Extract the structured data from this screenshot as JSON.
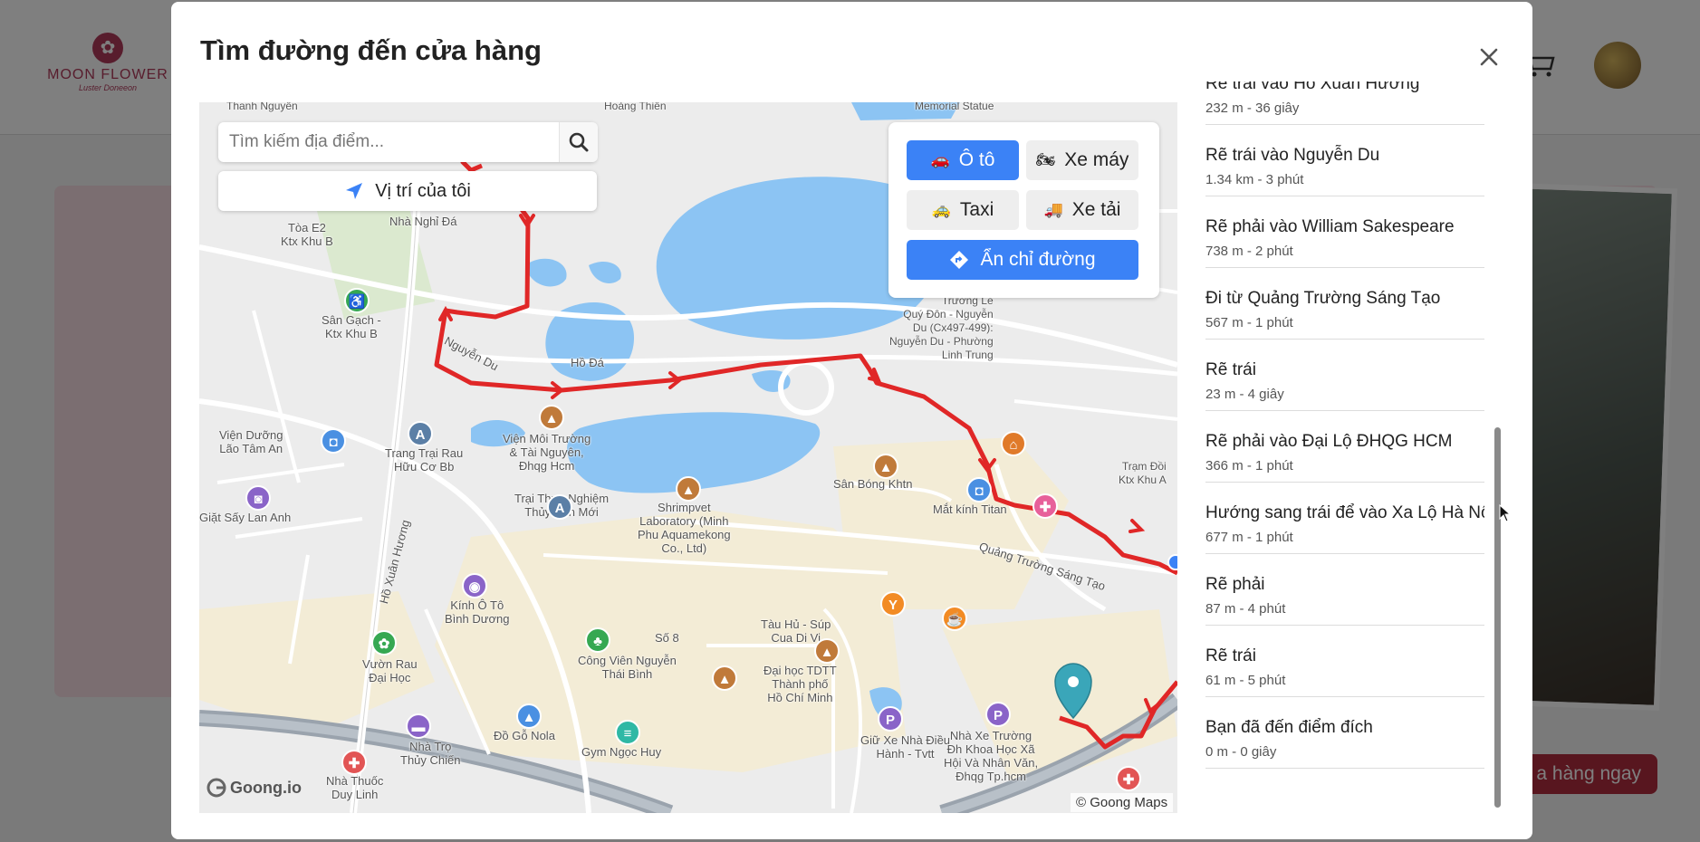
{
  "background": {
    "logo": {
      "name": "MOON FLOWER",
      "sub": "Luster Doneeon"
    },
    "cta_label": "a hàng ngay"
  },
  "modal": {
    "title": "Tìm đường đến cửa hàng",
    "close_icon": "close-icon"
  },
  "map": {
    "search_placeholder": "Tìm kiếm địa điểm...",
    "my_location_label": "Vị trí của tôi",
    "vehicles": [
      {
        "label": "Ô tô",
        "icon": "car-icon",
        "active": true
      },
      {
        "label": "Xe máy",
        "icon": "motorbike-icon",
        "active": false
      },
      {
        "label": "Taxi",
        "icon": "taxi-icon",
        "active": false
      },
      {
        "label": "Xe tải",
        "icon": "truck-icon",
        "active": false
      }
    ],
    "hide_route_label": "Ẩn chỉ đường",
    "brand": "Goong.io",
    "copyright": "© Goong Maps",
    "accent_color": "#3b82f6",
    "route_color": "#e02727",
    "labels": {
      "thanh_nguyen": "Thanh Nguyên",
      "hoang_thien": "Hoàng Thiên",
      "memorial": "Memorial Statue",
      "toa_e2": "Tòa E2\nKtx Khu B",
      "nha_nghi": "Nhà Nghỉ Đá",
      "san_gach": "Sân Gạch -\nKtx Khu B",
      "nguyen_du": "Nguyễn Du",
      "ho_da": "Hồ Đá",
      "truong_le": "Trường Lê\nQuý Đôn - Nguyễn\nDu (Cx497-499):\nNguyễn Du - Phường\nLinh Trung",
      "vien_duong_lao": "Viện Dưỡng\nLão Tâm An",
      "trang_trai": "Trang Trại Rau\nHữu Cơ Bb",
      "vien_moi_truong": "Viện Môi Trường\n& Tài Nguyên,\nĐhqg Hcm",
      "san_bong": "Sân Bóng Khtn",
      "tram_doi": "Trạm Đồi\nKtx Khu A",
      "giat_say": "Giặt Sấy Lan Anh",
      "trai_thuc_nghiem": "Trại Thực Nghiệm\nThủy Sản Mới",
      "shrimpvet": "Shrimpvet\nLaboratory (Minh\nPhu Aquamekong\nCo., Ltd)",
      "mat_kinh": "Mắt kính Titan",
      "quang_truong": "Quảng Trường Sáng Tạo",
      "ho_xuan_huong": "Hồ Xuân Hương",
      "kinh_o_to": "Kính Ô Tô\nBình Dương",
      "so_8": "Số 8",
      "tau_hu": "Tàu Hủ - Súp\nCua Di Vi",
      "vuon_rau": "Vườn Rau\nĐại Học",
      "cong_vien": "Công Viên Nguyễn\nThái Bình",
      "dai_hoc_tdtt": "Đại học TDTT\nThành phố\nHồ Chí Minh",
      "nha_tro": "Nhà Trọ\nThủy Chiến",
      "do_go": "Đồ Gỗ Nola",
      "gym": "Gym Ngọc Huy",
      "giu_xe": "Giữ Xe Nhà Điều\nHành - Tvtt",
      "nha_xe_truong": "Nhà Xe Trường\nĐh Khoa Học Xã\nHội Và Nhân Văn,\nĐhqg Tp.hcm",
      "nha_thuoc": "Nhà Thuốc\nDuy Linh"
    }
  },
  "directions": {
    "steps": [
      {
        "instruction": "Rẽ trái vào Hồ Xuân Hương",
        "meta": "232 m - 36 giây"
      },
      {
        "instruction": "Rẽ trái vào Nguyễn Du",
        "meta": "1.34 km - 3 phút"
      },
      {
        "instruction": "Rẽ phải vào William Sakespeare",
        "meta": "738 m - 2 phút"
      },
      {
        "instruction": "Đi từ Quảng Trường Sáng Tạo",
        "meta": "567 m - 1 phút"
      },
      {
        "instruction": "Rẽ trái",
        "meta": "23 m - 4 giây"
      },
      {
        "instruction": "Rẽ phải vào Đại Lộ ĐHQG HCM",
        "meta": "366 m - 1 phút"
      },
      {
        "instruction": "Hướng sang trái để vào Xa Lộ Hà Nội",
        "meta": "677 m - 1 phút"
      },
      {
        "instruction": "Rẽ phải",
        "meta": "87 m - 4 phút"
      },
      {
        "instruction": "Rẽ trái",
        "meta": "61 m - 5 phút"
      },
      {
        "instruction": "Bạn đã đến điểm đích",
        "meta": "0 m - 0 giây"
      }
    ]
  }
}
